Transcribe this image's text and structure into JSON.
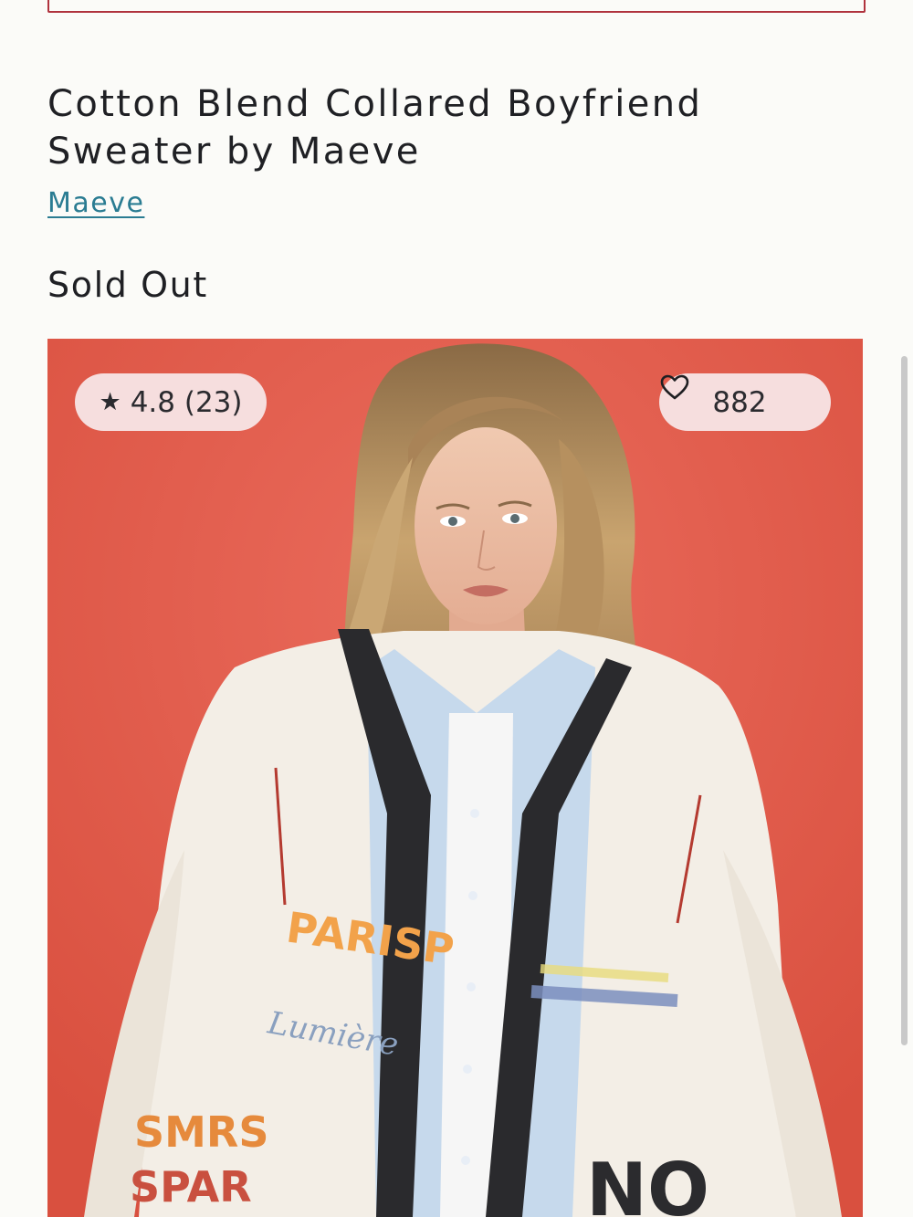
{
  "product": {
    "title": "Cotton Blend Collared Boyfriend Sweater by Maeve",
    "brand": "Maeve",
    "price_status": "Sold Out"
  },
  "image": {
    "rating_star": "★",
    "rating_text": "4.8 (23)",
    "likes_count": "882",
    "heart_icon": "heart-outline-icon",
    "sweater_text_left": "PARISP",
    "sweater_script": "Lumière",
    "sweater_text_bottom_1": "SMRS",
    "sweater_text_bottom_2": "SPAR",
    "sweater_text_right": "NO"
  },
  "colors": {
    "accent_border": "#b0333e",
    "brand_link": "#2a7c92",
    "photo_background": "#e35f50",
    "pill_background": "#f6dede"
  }
}
